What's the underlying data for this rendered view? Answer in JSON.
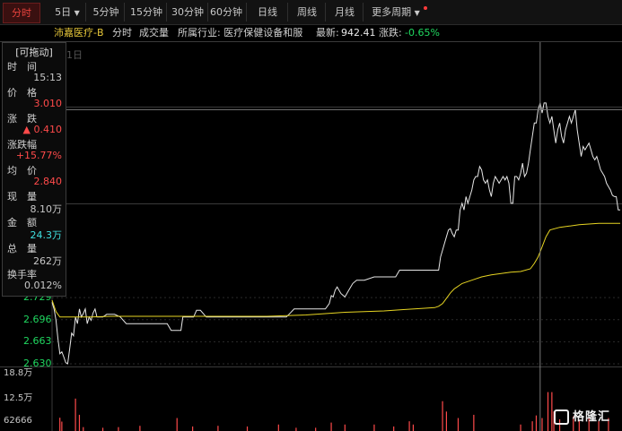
{
  "tabs": [
    {
      "label": "分时",
      "active": true
    },
    {
      "label": "5日",
      "dropdown": true
    },
    {
      "label": "5分钟"
    },
    {
      "label": "15分钟"
    },
    {
      "label": "30分钟"
    },
    {
      "label": "60分钟"
    },
    {
      "label": "日线"
    },
    {
      "label": "周线"
    },
    {
      "label": "月线"
    },
    {
      "label": "更多周期",
      "dropdown": true
    }
  ],
  "info": {
    "name": "沛嘉医疗-B",
    "mode": "分时",
    "volume_label": "成交量",
    "industry": "所属行业: 医疗保健设备和服",
    "latest_label": "最新:",
    "latest": "942.41",
    "change_label": "涨跌:",
    "change": "-0.65%"
  },
  "panel": {
    "title": "[可拖动]",
    "rows": [
      {
        "label": "时　间",
        "value": "15:13",
        "color": "gray"
      },
      {
        "label": "价　格",
        "value": "3.010",
        "color": "red"
      },
      {
        "label": "涨　跌",
        "value": "▲ 0.410",
        "color": "red"
      },
      {
        "label": "涨跌幅",
        "value": "+15.77%",
        "color": "red"
      },
      {
        "label": "均　价",
        "value": "2.840",
        "color": "red"
      },
      {
        "label": "现　量",
        "value": "8.10万",
        "color": "gray"
      },
      {
        "label": "金　额",
        "value": "24.3万",
        "color": "cyan"
      },
      {
        "label": "总　量",
        "value": "262万",
        "color": "gray"
      },
      {
        "label": "换手率",
        "value": "0.012%",
        "color": "gray"
      }
    ]
  },
  "top_date_label": "1日",
  "logo_text": "格隆汇",
  "colors": {
    "price": "#e6e6e6",
    "avg": "#e6d422",
    "up": "#ff4a4a",
    "down": "#20d860",
    "grid": "#2b2b2b"
  },
  "chart_data": {
    "type": "line",
    "price_axis": {
      "ticks": [
        2.729,
        2.696,
        2.663,
        2.63
      ],
      "ylim": [
        2.63,
        3.04
      ]
    },
    "volume_axis": {
      "ticks": [
        "18.8万",
        "12.5万",
        "62666"
      ],
      "ylim": [
        0,
        188000
      ]
    },
    "series": [
      {
        "points": [
          [
            0,
            2.722
          ],
          [
            2,
            2.712
          ],
          [
            4,
            2.695
          ],
          [
            6,
            2.668
          ],
          [
            8,
            2.645
          ],
          [
            10,
            2.648
          ],
          [
            12,
            2.64
          ],
          [
            14,
            2.632
          ],
          [
            16,
            2.63
          ],
          [
            18,
            2.652
          ],
          [
            20,
            2.676
          ],
          [
            22,
            2.672
          ],
          [
            24,
            2.7
          ],
          [
            26,
            2.69
          ],
          [
            28,
            2.712
          ],
          [
            30,
            2.7
          ],
          [
            32,
            2.705
          ],
          [
            34,
            2.712
          ],
          [
            36,
            2.69
          ],
          [
            38,
            2.7
          ],
          [
            40,
            2.695
          ],
          [
            42,
            2.706
          ],
          [
            44,
            2.712
          ],
          [
            46,
            2.7
          ],
          [
            48,
            2.7
          ],
          [
            52,
            2.7
          ],
          [
            56,
            2.704
          ],
          [
            60,
            2.704
          ],
          [
            64,
            2.704
          ],
          [
            70,
            2.7
          ],
          [
            76,
            2.69
          ],
          [
            80,
            2.69
          ],
          [
            86,
            2.69
          ],
          [
            90,
            2.69
          ],
          [
            96,
            2.69
          ],
          [
            100,
            2.69
          ],
          [
            106,
            2.69
          ],
          [
            110,
            2.69
          ],
          [
            114,
            2.69
          ],
          [
            118,
            2.69
          ],
          [
            122,
            2.68
          ],
          [
            126,
            2.68
          ],
          [
            132,
            2.68
          ],
          [
            134,
            2.7
          ],
          [
            138,
            2.7
          ],
          [
            142,
            2.7
          ],
          [
            145,
            2.7
          ],
          [
            148,
            2.71
          ],
          [
            152,
            2.71
          ],
          [
            158,
            2.7
          ],
          [
            162,
            2.7
          ],
          [
            170,
            2.7
          ],
          [
            180,
            2.7
          ],
          [
            190,
            2.7
          ],
          [
            200,
            2.7
          ],
          [
            210,
            2.7
          ],
          [
            220,
            2.7
          ],
          [
            230,
            2.7
          ],
          [
            236,
            2.7
          ],
          [
            240,
            2.7
          ],
          [
            244,
            2.706
          ],
          [
            248,
            2.712
          ],
          [
            252,
            2.712
          ],
          [
            260,
            2.712
          ],
          [
            266,
            2.712
          ],
          [
            270,
            2.712
          ],
          [
            276,
            2.712
          ],
          [
            280,
            2.712
          ],
          [
            284,
            2.72
          ],
          [
            286,
            2.732
          ],
          [
            288,
            2.73
          ],
          [
            290,
            2.74
          ],
          [
            292,
            2.745
          ],
          [
            296,
            2.735
          ],
          [
            300,
            2.73
          ],
          [
            304,
            2.74
          ],
          [
            308,
            2.75
          ],
          [
            312,
            2.755
          ],
          [
            320,
            2.755
          ],
          [
            330,
            2.76
          ],
          [
            336,
            2.76
          ],
          [
            342,
            2.76
          ],
          [
            348,
            2.76
          ],
          [
            352,
            2.76
          ],
          [
            356,
            2.77
          ],
          [
            360,
            2.77
          ],
          [
            366,
            2.77
          ],
          [
            372,
            2.77
          ],
          [
            380,
            2.77
          ],
          [
            386,
            2.77
          ],
          [
            392,
            2.77
          ],
          [
            396,
            2.77
          ],
          [
            398,
            2.79
          ],
          [
            400,
            2.8
          ],
          [
            402,
            2.81
          ],
          [
            404,
            2.82
          ],
          [
            406,
            2.83
          ],
          [
            408,
            2.832
          ],
          [
            410,
            2.825
          ],
          [
            412,
            2.82
          ],
          [
            414,
            2.83
          ],
          [
            416,
            2.83
          ],
          [
            418,
            2.86
          ],
          [
            420,
            2.87
          ],
          [
            422,
            2.86
          ],
          [
            424,
            2.88
          ],
          [
            426,
            2.87
          ],
          [
            428,
            2.88
          ],
          [
            430,
            2.89
          ],
          [
            432,
            2.905
          ],
          [
            434,
            2.91
          ],
          [
            436,
            2.91
          ],
          [
            438,
            2.925
          ],
          [
            440,
            2.92
          ],
          [
            442,
            2.905
          ],
          [
            444,
            2.9
          ],
          [
            446,
            2.905
          ],
          [
            448,
            2.89
          ],
          [
            450,
            2.88
          ],
          [
            452,
            2.9
          ],
          [
            454,
            2.91
          ],
          [
            456,
            2.905
          ],
          [
            458,
            2.9
          ],
          [
            460,
            2.905
          ],
          [
            462,
            2.91
          ],
          [
            464,
            2.905
          ],
          [
            466,
            2.91
          ],
          [
            468,
            2.9
          ],
          [
            470,
            2.87
          ],
          [
            472,
            2.87
          ],
          [
            474,
            2.91
          ],
          [
            476,
            2.91
          ],
          [
            478,
            2.905
          ],
          [
            480,
            2.915
          ],
          [
            482,
            2.93
          ],
          [
            484,
            2.91
          ],
          [
            486,
            2.915
          ],
          [
            488,
            2.93
          ],
          [
            490,
            2.95
          ],
          [
            492,
            2.97
          ],
          [
            494,
            2.99
          ],
          [
            496,
            2.99
          ],
          [
            498,
            3.01
          ],
          [
            500,
            3.02
          ],
          [
            502,
            3.005
          ],
          [
            504,
            3.02
          ],
          [
            506,
            3.02
          ],
          [
            508,
            3.0
          ],
          [
            510,
            2.99
          ],
          [
            512,
            3.0
          ],
          [
            514,
            2.98
          ],
          [
            516,
            2.96
          ],
          [
            518,
            2.98
          ],
          [
            520,
            2.99
          ],
          [
            522,
            2.97
          ],
          [
            524,
            2.96
          ],
          [
            526,
            2.98
          ],
          [
            528,
            2.99
          ],
          [
            530,
            3.0
          ],
          [
            532,
            2.99
          ],
          [
            534,
            3.0
          ],
          [
            536,
            3.01
          ],
          [
            538,
            2.98
          ],
          [
            540,
            2.96
          ],
          [
            542,
            2.94
          ],
          [
            544,
            2.955
          ],
          [
            546,
            2.95
          ],
          [
            548,
            2.955
          ],
          [
            550,
            2.96
          ],
          [
            552,
            2.95
          ],
          [
            554,
            2.94
          ],
          [
            556,
            2.935
          ],
          [
            558,
            2.94
          ],
          [
            560,
            2.93
          ],
          [
            562,
            2.92
          ],
          [
            564,
            2.915
          ],
          [
            566,
            2.91
          ],
          [
            568,
            2.9
          ],
          [
            570,
            2.895
          ],
          [
            572,
            2.89
          ],
          [
            574,
            2.882
          ],
          [
            576,
            2.88
          ],
          [
            578,
            2.88
          ],
          [
            580,
            2.86
          ],
          [
            582,
            2.86
          ]
        ]
      },
      {
        "points": [
          [
            0,
            2.725
          ],
          [
            4,
            2.708
          ],
          [
            8,
            2.7
          ],
          [
            14,
            2.7
          ],
          [
            20,
            2.7
          ],
          [
            30,
            2.7
          ],
          [
            40,
            2.7
          ],
          [
            60,
            2.701
          ],
          [
            80,
            2.701
          ],
          [
            100,
            2.701
          ],
          [
            120,
            2.701
          ],
          [
            140,
            2.701
          ],
          [
            160,
            2.701
          ],
          [
            180,
            2.701
          ],
          [
            200,
            2.701
          ],
          [
            220,
            2.701
          ],
          [
            240,
            2.702
          ],
          [
            260,
            2.703
          ],
          [
            280,
            2.705
          ],
          [
            290,
            2.706
          ],
          [
            300,
            2.707
          ],
          [
            320,
            2.708
          ],
          [
            340,
            2.709
          ],
          [
            360,
            2.711
          ],
          [
            380,
            2.713
          ],
          [
            392,
            2.714
          ],
          [
            396,
            2.716
          ],
          [
            400,
            2.72
          ],
          [
            404,
            2.728
          ],
          [
            408,
            2.736
          ],
          [
            412,
            2.742
          ],
          [
            420,
            2.75
          ],
          [
            430,
            2.755
          ],
          [
            440,
            2.76
          ],
          [
            450,
            2.763
          ],
          [
            460,
            2.765
          ],
          [
            470,
            2.767
          ],
          [
            480,
            2.768
          ],
          [
            490,
            2.772
          ],
          [
            494,
            2.78
          ],
          [
            498,
            2.79
          ],
          [
            502,
            2.805
          ],
          [
            506,
            2.82
          ],
          [
            510,
            2.83
          ],
          [
            520,
            2.834
          ],
          [
            530,
            2.836
          ],
          [
            540,
            2.838
          ],
          [
            550,
            2.839
          ],
          [
            560,
            2.84
          ],
          [
            570,
            2.84
          ],
          [
            580,
            2.84
          ],
          [
            582,
            2.84
          ]
        ]
      }
    ],
    "volume": [
      [
        8,
        41000
      ],
      [
        10,
        29000
      ],
      [
        24,
        100000
      ],
      [
        28,
        50000
      ],
      [
        32,
        12000
      ],
      [
        52,
        10000
      ],
      [
        68,
        12000
      ],
      [
        90,
        16000
      ],
      [
        128,
        40000
      ],
      [
        144,
        14000
      ],
      [
        170,
        16000
      ],
      [
        200,
        14000
      ],
      [
        232,
        20000
      ],
      [
        250,
        10000
      ],
      [
        270,
        10000
      ],
      [
        286,
        26000
      ],
      [
        300,
        20000
      ],
      [
        330,
        20000
      ],
      [
        350,
        14000
      ],
      [
        366,
        30000
      ],
      [
        370,
        20000
      ],
      [
        400,
        92000
      ],
      [
        404,
        60000
      ],
      [
        416,
        40000
      ],
      [
        432,
        50000
      ],
      [
        480,
        20000
      ],
      [
        492,
        30000
      ],
      [
        496,
        48000
      ],
      [
        502,
        40000
      ],
      [
        508,
        120000
      ],
      [
        512,
        120000
      ],
      [
        514,
        60000
      ],
      [
        520,
        36000
      ],
      [
        534,
        45000
      ],
      [
        540,
        35000
      ],
      [
        550,
        40000
      ],
      [
        560,
        30000
      ],
      [
        570,
        40000
      ]
    ]
  }
}
